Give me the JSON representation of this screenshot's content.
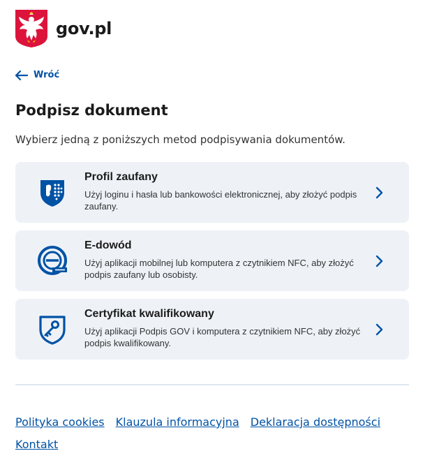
{
  "header": {
    "brand": "gov.pl",
    "emblem": "polish-eagle-emblem"
  },
  "nav": {
    "back_label": "Wróć"
  },
  "page": {
    "title": "Podpisz dokument",
    "intro": "Wybierz jedną z poniższych metod podpisywania dokumentów."
  },
  "methods": [
    {
      "title": "Profil zaufany",
      "description": "Użyj loginu i hasła lub bankowości elektronicznej, aby złożyć podpis zaufany.",
      "icon": "trusted-profile-icon"
    },
    {
      "title": "E-dowód",
      "description": "Użyj aplikacji mobilnej lub komputera z czytnikiem NFC, aby złożyć podpis zaufany lub osobisty.",
      "icon": "e-id-icon"
    },
    {
      "title": "Certyfikat kwalifikowany",
      "description": "Użyj aplikacji Podpis GOV i komputera z czytnikiem NFC, aby złożyć podpis kwalifikowany.",
      "icon": "shield-key-icon"
    }
  ],
  "footer": {
    "links": [
      "Polityka cookies",
      "Klauzula informacyjna",
      "Deklaracja dostępności",
      "Kontakt"
    ]
  },
  "colors": {
    "accent": "#0052a5",
    "card_bg": "#eef2f7",
    "emblem_red": "#dc143c"
  }
}
